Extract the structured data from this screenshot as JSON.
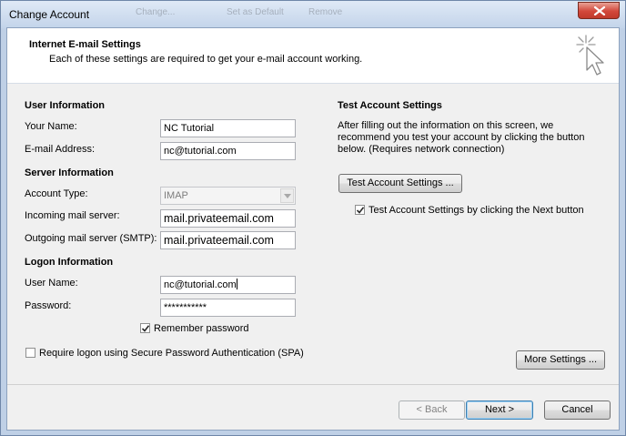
{
  "window": {
    "title": "Change Account"
  },
  "taskbar_ghost": [
    "Change...",
    "Set as Default",
    "Remove"
  ],
  "header": {
    "title": "Internet E-mail Settings",
    "subtitle": "Each of these settings are required to get your e-mail account working."
  },
  "user_info": {
    "heading": "User Information",
    "name_label": "Your Name:",
    "name_value": "NC Tutorial",
    "email_label": "E-mail Address:",
    "email_value": "nc@tutorial.com"
  },
  "server_info": {
    "heading": "Server Information",
    "account_type_label": "Account Type:",
    "account_type_value": "IMAP",
    "incoming_label": "Incoming mail server:",
    "incoming_value": "mail.privateemail.com",
    "outgoing_label": "Outgoing mail server (SMTP):",
    "outgoing_value": "mail.privateemail.com"
  },
  "logon_info": {
    "heading": "Logon Information",
    "username_label": "User Name:",
    "username_value": "nc@tutorial.com",
    "password_label": "Password:",
    "password_value": "***********",
    "remember_label": "Remember password",
    "remember_checked": true,
    "spa_label": "Require logon using Secure Password Authentication (SPA)",
    "spa_checked": false
  },
  "test_settings": {
    "heading": "Test Account Settings",
    "description": "After filling out the information on this screen, we recommend you test your account by clicking the button below. (Requires network connection)",
    "test_button": "Test Account Settings ...",
    "auto_test_label": "Test Account Settings by clicking the Next button",
    "auto_test_checked": true
  },
  "buttons": {
    "more_settings": "More Settings ...",
    "back": "< Back",
    "next": "Next >",
    "cancel": "Cancel"
  }
}
